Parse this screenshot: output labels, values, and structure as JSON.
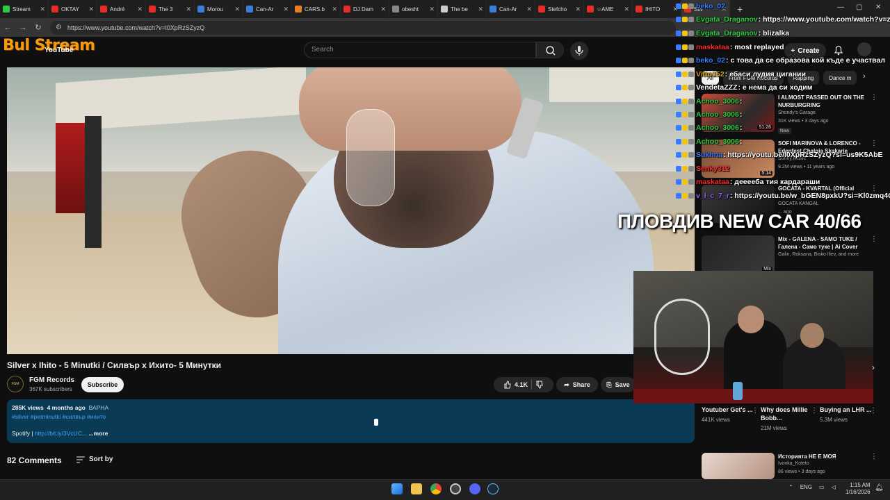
{
  "browser": {
    "tabs": [
      "Stream",
      "OKTAY",
      "André",
      "The 3",
      "Morou",
      "Can-Ar",
      "CARS.b",
      "DJ Dam",
      "obesht",
      "The be",
      "Can-Ar",
      "Stefcho",
      "☆AME",
      "IHITO",
      "Silv"
    ],
    "url": "https://www.youtube.com/watch?v=l0XpRzSZyzQ"
  },
  "header": {
    "logo_text": "Bul Stream",
    "youtube_text": "YouTube",
    "search_placeholder": "Search",
    "create_label": "Create"
  },
  "video": {
    "title": "Silver x Ihito - 5 Minutki / Силвър х Ихито- 5 Минутки",
    "channel_name": "FGM Records",
    "channel_avatar_text": "FGM",
    "subscribers": "367K subscribers",
    "subscribe_label": "Subscribe",
    "likes": "4.1K",
    "share_label": "Share",
    "save_label": "Save"
  },
  "description": {
    "views": "285K views",
    "age": "4 months ago",
    "highlight": "ВАРНА",
    "tags": "#silver #petminutki #силвър #ихито",
    "spotify_label": "Spotify |",
    "spotify_link": "http://bit.ly/3VcUC...",
    "more": "...more"
  },
  "comments": {
    "title": "82 Comments",
    "sort_label": "Sort by"
  },
  "sidebar": {
    "chips": [
      "All",
      "From FGM Records",
      "Rapping",
      "Dance m"
    ],
    "recommendations": [
      {
        "title": "I ALMOST PASSED OUT ON THE NURBURGRING",
        "channel": "Shondy's Garage",
        "meta": "31K views • 3 days ago",
        "duration": "51:26",
        "badge": "New"
      },
      {
        "title": "SOFI MARINOVA & LORENCO - Edenfest Chalgia Skakarie",
        "channel": "Sunny Music",
        "meta": "9.2M views • 11 years ago",
        "duration": "5:14",
        "badge": ""
      },
      {
        "title": "GOCATA - KVARTAL (Official",
        "channel": "GOCATA KANGAL",
        "meta": "... ago",
        "duration": "",
        "badge": ""
      },
      {
        "title": "Mix - GALENA - SAMO TUKE / Галена - Само туке | Ai Cover",
        "channel": "Galin, Roksana, Bisko Iliev, and more",
        "meta": "",
        "duration": "Mix",
        "badge": ""
      }
    ],
    "bottom_item": {
      "title": "Историята НЕ Е МОЯ",
      "channel": "Ivonka_Koteto",
      "meta": "86 views • 3 days ago"
    }
  },
  "shorts": [
    {
      "title": "Youtuber Get's ...",
      "views": "441K views"
    },
    {
      "title": "Why does Millie Bobb...",
      "views": "21M views"
    },
    {
      "title": "Buying an LHR ...",
      "views": "5.3M views"
    }
  ],
  "chat": [
    {
      "user": "beko_02",
      "msg": "",
      "color": "#3a7bff"
    },
    {
      "user": "Evgata_Draganov",
      "msg": ": https://www.youtube.com/watch?v=zt",
      "color": "#2ecc40"
    },
    {
      "user": "Evgata_Draganov",
      "msg": ": blizalka",
      "color": "#2ecc40"
    },
    {
      "user": "maskataa",
      "msg": ": most replayed",
      "color": "#ff2a2a"
    },
    {
      "user": "beko_02",
      "msg": ": с това да се образова кой къде е участвал",
      "color": "#3a7bff"
    },
    {
      "user": "Vitto152",
      "msg": ": ебаси лудия цигании",
      "color": "#d4a017"
    },
    {
      "user": "VendetaZZZ",
      "msg": ": е нема да си ходим",
      "color": "#ffffff"
    },
    {
      "user": "Achoo_3006",
      "msg": ":",
      "color": "#2ecc40"
    },
    {
      "user": "Achoo_3006",
      "msg": ":",
      "color": "#2ecc40"
    },
    {
      "user": "Achoo_3006",
      "msg": ":",
      "color": "#2ecc40"
    },
    {
      "user": "Achoo_3006",
      "msg": ":",
      "color": "#2ecc40"
    },
    {
      "user": "Sukhna",
      "msg": ": https://youtu.be/l0XpRzSZyzQ?si=us9K5AbE",
      "color": "#3a7bff"
    },
    {
      "user": "Senky312",
      "msg": "",
      "color": "#ff2a2a"
    },
    {
      "user": "maskataa",
      "msg": ": дееееба тия кардараши",
      "color": "#ff2a2a"
    },
    {
      "user": "v_l_c_7_r",
      "msg": ": https://youtu.be/w_bGEN8pxkU?si=Kl0zmq4Q9Hmi",
      "color": "#9b59ff"
    }
  ],
  "overlay_text": "ПЛОВДИВ NEW CAR 40/66",
  "taskbar": {
    "lang": "ENG",
    "time": "1:15 AM",
    "date": "1/16/2026"
  }
}
